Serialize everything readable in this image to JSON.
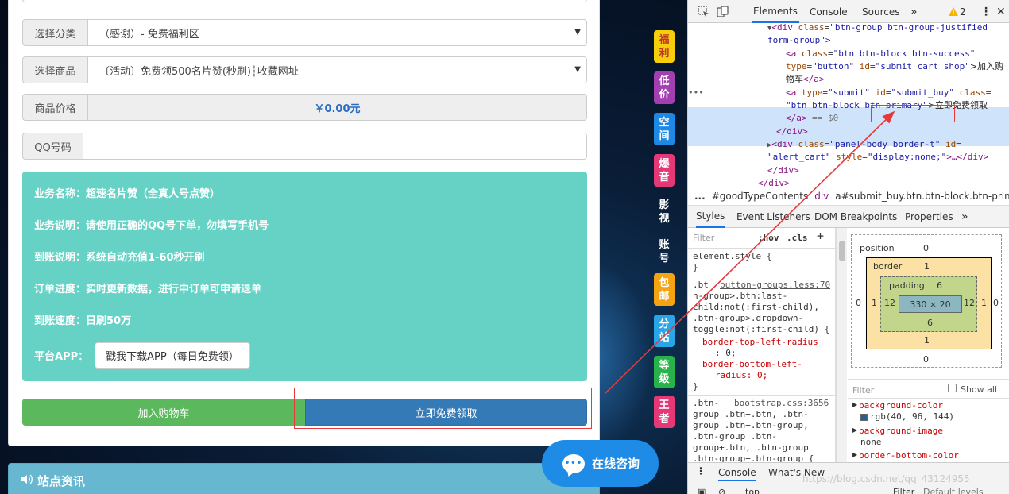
{
  "form": {
    "category_label": "选择分类",
    "category_value": "（感谢）- 免费福利区",
    "product_label": "选择商品",
    "product_value": "〔活动〕免费领500名片赞(秒刷)┆收藏网址",
    "price_label": "商品价格",
    "price_value": "￥0.00元",
    "qq_label": "QQ号码",
    "qq_value": ""
  },
  "info": {
    "lines": [
      "业务名称：超速名片赞（全真人号点赞）",
      "业务说明：请使用正确的QQ号下单，勿填写手机号",
      "到账说明：系统自动充值1-60秒开刷",
      "订单进度：实时更新数据，进行中订单可申请退单",
      "到账速度：日刷50万"
    ],
    "app_label": "平台APP：",
    "app_button": "戳我下载APP（每日免费领）"
  },
  "buttons": {
    "cart": "加入购物车",
    "buy": "立即免费领取"
  },
  "news": {
    "title": "站点资讯"
  },
  "side_tags": [
    {
      "text": "福利",
      "color": "#f6cf0b",
      "text_color": "#c0392b"
    },
    {
      "text": "低价",
      "color": "#a33fb0",
      "text_color": "#ffffff"
    },
    {
      "text": "空间",
      "color": "#1e88e5",
      "text_color": "#ffffff"
    },
    {
      "text": "爆音",
      "color": "#e53977",
      "text_color": "#ffffff"
    },
    {
      "text": "影视",
      "color": "transparent",
      "text_color": "#ffffff"
    },
    {
      "text": "账号",
      "color": "transparent",
      "text_color": "#ffffff"
    },
    {
      "text": "包邮",
      "color": "#f5a310",
      "text_color": "#ffffff"
    },
    {
      "text": "分站",
      "color": "#29a6e8",
      "text_color": "#ffffff"
    },
    {
      "text": "等级",
      "color": "#28b34a",
      "text_color": "#ffffff"
    },
    {
      "text": "王者",
      "color": "#e53977",
      "text_color": "#ffffff"
    }
  ],
  "chat": {
    "label": "在线咨询"
  },
  "devtools": {
    "tabs": [
      "Elements",
      "Console",
      "Sources"
    ],
    "warnings": "2",
    "dom": {
      "l1_tag": "<div",
      "l1_attr": "class",
      "l1_val": "\"btn-group btn-group-justified",
      "l1b": "form-group\">",
      "l2_tag": "<a",
      "l2_attr": "class",
      "l2_val": "\"btn btn-block btn-success\"",
      "l3_attr1": "type",
      "l3_val1": "\"button\"",
      "l3_attr2": "id",
      "l3_val2": "\"submit_cart_shop\"",
      "l3_text": ">加入购",
      "l4_text": "物车",
      "l4_close": "</a>",
      "l5_tag": "<a",
      "l5_attr1": "type",
      "l5_val1": "\"submit\"",
      "l5_attr2": "id",
      "l5_val2": "\"submit_buy\"",
      "l5_attr3": "class",
      "l6_val": "\"btn btn-block btn-primary\"",
      "l6_text": ">立即免费领取",
      "l7_close": "</a>",
      "l7_eq": " == $0",
      "l8_close": "</div>",
      "l9_tag": "<div",
      "l9_attr": "class",
      "l9_val": "\"panel-body border-t\"",
      "l9_attr2": "id",
      "l10_val": "\"alert_cart\"",
      "l10_attr": "style",
      "l10_val2": "\"display:none;\"",
      "l10_rest": ">…</div>",
      "l11_close": "</div>",
      "l12_close": "</div>"
    },
    "breadcrumbs": [
      "#goodTypeContents",
      "div",
      "a#submit_buy.btn.btn-block.btn-primary"
    ],
    "sub_tabs": [
      "Styles",
      "Event Listeners",
      "DOM Breakpoints",
      "Properties"
    ],
    "filter_placeholder": "Filter",
    "hov": ":hov",
    "cls": ".cls",
    "styles": {
      "element_style": "element.style {",
      "close": "}",
      "rule1_src": "button-groups.less:70",
      "rule1_sel_a": ".bt",
      "rule1_sel_b": "n-group>.btn:last-",
      "rule1_sel_c": "child:not(:first-child),",
      "rule1_sel_d": ".btn-group>.dropdown-",
      "rule1_sel_e": "toggle:not(:first-child) {",
      "rule1_p1": "border-top-left-radius",
      "rule1_v1": ": 0;",
      "rule1_p2": "border-bottom-left-",
      "rule1_v2": "radius: 0;",
      "rule2_src": "bootstrap.css:3656",
      "rule2_a": ".btn-",
      "rule2_b": "group .btn+.btn, .btn-",
      "rule2_c": "group .btn+.btn-group,",
      "rule2_d": ".btn-group .btn-",
      "rule2_e": "group+.btn, .btn-group",
      "rule2_f": ".btn-group+.btn-group {"
    },
    "box_model": {
      "position_label": "position",
      "position_value": "0",
      "border_label": "border",
      "border_value": "1",
      "padding_label": "padding",
      "padding_value": "6",
      "content": "330 × 20",
      "side_12": "12",
      "side_1": "1",
      "side_0": "0",
      "pad_bottom": "6",
      "border_bottom": "1",
      "pos_bottom": "0"
    },
    "computed": {
      "filter_placeholder": "Filter",
      "show_all": "Show all",
      "p1": "background-color",
      "v1": "rgb(40, 96, 144)",
      "p2": "background-image",
      "v2": "none",
      "p3": "border-bottom-color"
    },
    "drawer_tabs": [
      "Console",
      "What's New"
    ],
    "drawer_top": "top",
    "drawer_filter": "Filter",
    "drawer_levels": "Default levels"
  },
  "watermark": "https://blog.csdn.net/qq_43124955",
  "colors": {
    "cart": "#5cb85c",
    "buy": "#337ab7",
    "info_bg": "#66d2c5",
    "news_bg": "#67b7d1",
    "annotation": "#e5393b",
    "swatch": "#286090"
  }
}
